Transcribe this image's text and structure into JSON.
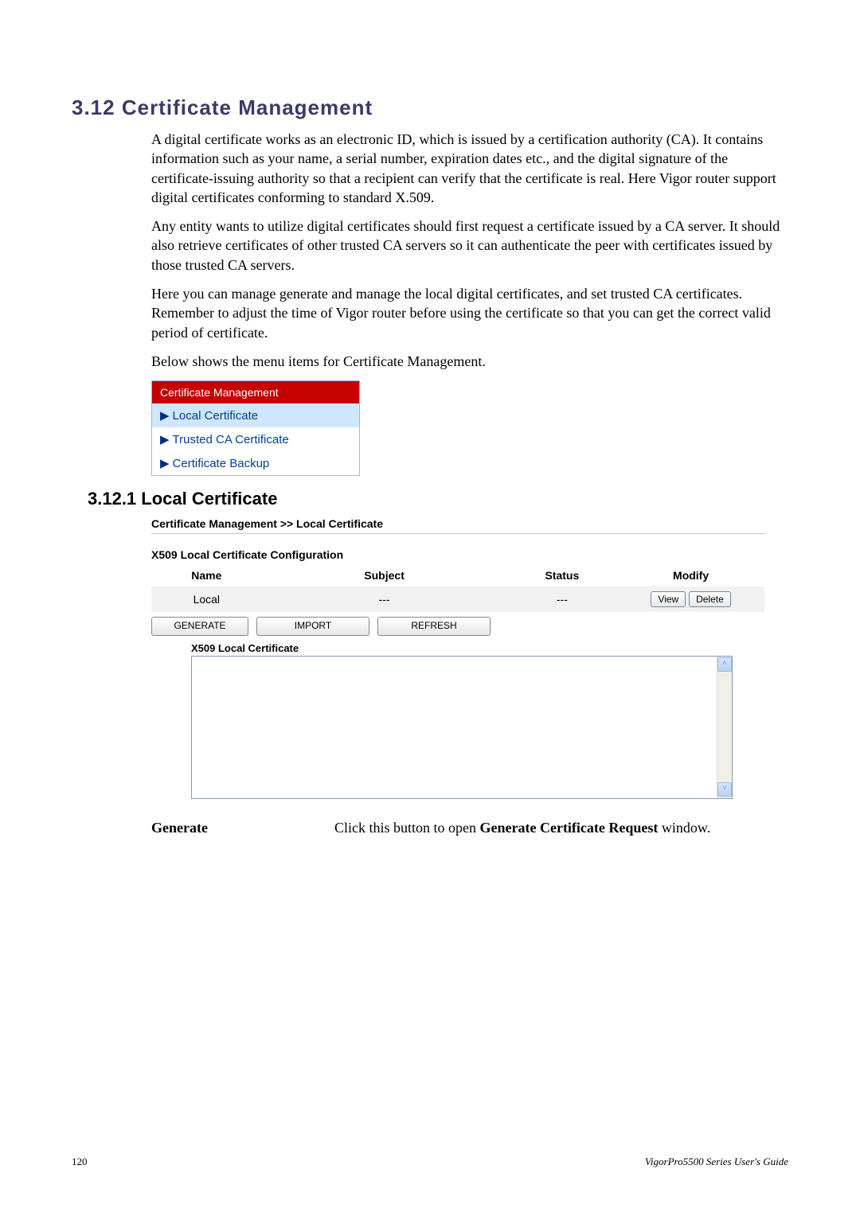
{
  "section": {
    "heading": "3.12 Certificate Management",
    "para1": "A digital certificate works as an electronic ID, which is issued by a certification authority (CA). It contains information such as your name, a serial number, expiration dates etc., and the digital signature of the certificate-issuing authority so that a recipient can verify that the certificate is real. Here Vigor router support digital certificates conforming to standard X.509.",
    "para2": "Any entity wants to utilize digital certificates should first request a certificate issued by a CA server. It should also retrieve certificates of other trusted CA servers so it can authenticate the peer with certificates issued by those trusted CA servers.",
    "para3": "Here you can manage generate and manage the local digital certificates, and set trusted CA certificates. Remember to adjust the time of Vigor router before using the certificate so that you can get the correct valid period of certificate.",
    "para4": "Below shows the menu items for Certificate Management."
  },
  "sidemenu": {
    "header": "Certificate Management",
    "items": [
      "Local Certificate",
      "Trusted CA Certificate",
      "Certificate Backup"
    ]
  },
  "subsection": {
    "heading": "3.12.1 Local Certificate"
  },
  "panel": {
    "breadcrumb": "Certificate Management >> Local Certificate",
    "config_title": "X509 Local Certificate Configuration",
    "columns": {
      "name": "Name",
      "subject": "Subject",
      "status": "Status",
      "modify": "Modify"
    },
    "row": {
      "name": "Local",
      "subject": "---",
      "status": "---",
      "view": "View",
      "delete": "Delete"
    },
    "buttons": {
      "generate": "GENERATE",
      "import": "IMPORT",
      "refresh": "REFRESH"
    },
    "x509_title": "X509 Local Certificate"
  },
  "definition": {
    "term": "Generate",
    "desc_pre": "Click this button to open ",
    "desc_strong": "Generate Certificate Request",
    "desc_post": " window."
  },
  "footer": {
    "page": "120",
    "guide": "VigorPro5500 Series User's Guide"
  }
}
